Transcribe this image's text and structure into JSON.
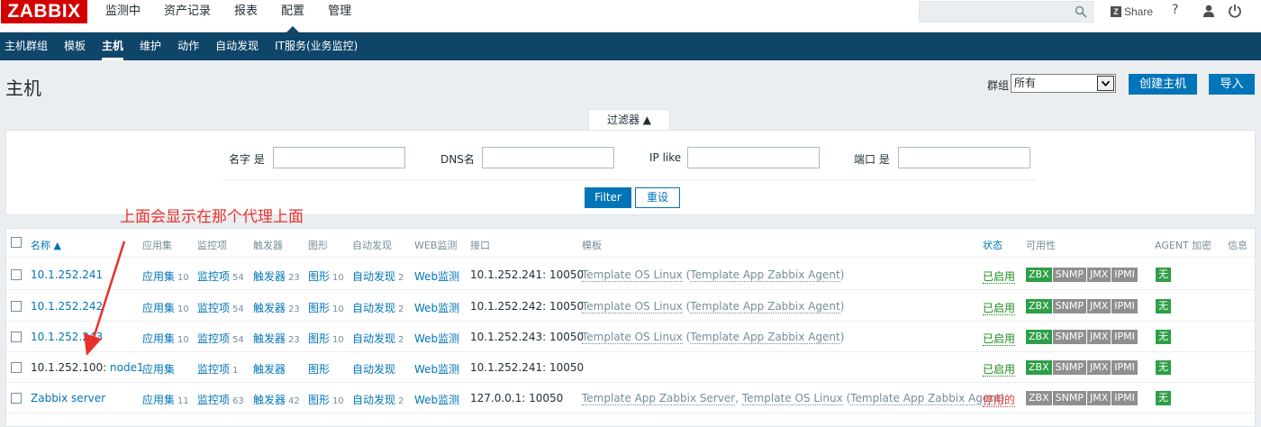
{
  "header": {
    "logo": "ZABBIX",
    "menu": [
      "监测中",
      "资产记录",
      "报表",
      "配置",
      "管理"
    ],
    "share": "Share",
    "share_box": "Z",
    "help": "?"
  },
  "subnav": [
    "主机群组",
    "模板",
    "主机",
    "维护",
    "动作",
    "自动发现",
    "IT服务(业务监控)"
  ],
  "page": {
    "title": "主机",
    "group_label": "群组",
    "group_value": "所有",
    "create_button": "创建主机",
    "import_button": "导入"
  },
  "filter": {
    "tab_label": "过滤器 ▲",
    "name_label": "名字 是",
    "dns_label": "DNS名",
    "ip_label": "IP like",
    "port_label": "端口 是",
    "filter_button": "Filter",
    "reset_button": "重设"
  },
  "annotation": "上面会显示在那个代理上面",
  "table": {
    "headers": {
      "name": "名称 ▲",
      "apps": "应用集",
      "items": "监控项",
      "triggers": "触发器",
      "graphs": "图形",
      "discovery": "自动发现",
      "web": "WEB监测",
      "interface": "接口",
      "templates": "模板",
      "status": "状态",
      "availability": "可用性",
      "encryption": "AGENT 加密",
      "info": "信息"
    },
    "rows": [
      {
        "name": "10.1.252.241",
        "proxy": "",
        "apps": "应用集",
        "apps_count": "10",
        "items": "监控项",
        "items_count": "54",
        "triggers": "触发器",
        "triggers_count": "23",
        "graphs": "图形",
        "graphs_count": "10",
        "discovery": "自动发现",
        "discovery_count": "2",
        "web": "Web监测",
        "interface": "10.1.252.241: 10050",
        "tmpl_1": "Template OS Linux",
        "tmpl_2": "",
        "tmpl_paren": "Template App Zabbix Agent",
        "status": "已启用",
        "zbx": "ZBX",
        "snmp": "SNMP",
        "jmx": "JMX",
        "ipmi": "IPMI",
        "encryption": "无"
      },
      {
        "name": "10.1.252.242",
        "proxy": "",
        "apps": "应用集",
        "apps_count": "10",
        "items": "监控项",
        "items_count": "54",
        "triggers": "触发器",
        "triggers_count": "23",
        "graphs": "图形",
        "graphs_count": "10",
        "discovery": "自动发现",
        "discovery_count": "2",
        "web": "Web监测",
        "interface": "10.1.252.242: 10050",
        "tmpl_1": "Template OS Linux",
        "tmpl_2": "",
        "tmpl_paren": "Template App Zabbix Agent",
        "status": "已启用",
        "zbx": "ZBX",
        "snmp": "SNMP",
        "jmx": "JMX",
        "ipmi": "IPMI",
        "encryption": "无"
      },
      {
        "name": "10.1.252.243",
        "proxy": "",
        "apps": "应用集",
        "apps_count": "10",
        "items": "监控项",
        "items_count": "54",
        "triggers": "触发器",
        "triggers_count": "23",
        "graphs": "图形",
        "graphs_count": "10",
        "discovery": "自动发现",
        "discovery_count": "2",
        "web": "Web监测",
        "interface": "10.1.252.243: 10050",
        "tmpl_1": "Template OS Linux",
        "tmpl_2": "",
        "tmpl_paren": "Template App Zabbix Agent",
        "status": "已启用",
        "zbx": "ZBX",
        "snmp": "SNMP",
        "jmx": "JMX",
        "ipmi": "IPMI",
        "encryption": "无"
      },
      {
        "name": "node1",
        "proxy": "10.1.252.100:",
        "apps": "应用集",
        "apps_count": "",
        "items": "监控项",
        "items_count": "1",
        "triggers": "触发器",
        "triggers_count": "",
        "graphs": "图形",
        "graphs_count": "",
        "discovery": "自动发现",
        "discovery_count": "",
        "web": "Web监测",
        "interface": "10.1.252.241: 10050",
        "tmpl_1": "",
        "tmpl_2": "",
        "tmpl_paren": "",
        "status": "已启用",
        "zbx": "ZBX",
        "snmp": "SNMP",
        "jmx": "JMX",
        "ipmi": "IPMI",
        "encryption": "无"
      },
      {
        "name": "Zabbix server",
        "proxy": "",
        "apps": "应用集",
        "apps_count": "11",
        "items": "监控项",
        "items_count": "63",
        "triggers": "触发器",
        "triggers_count": "42",
        "graphs": "图形",
        "graphs_count": "10",
        "discovery": "自动发现",
        "discovery_count": "2",
        "web": "Web监测",
        "interface": "127.0.0.1: 10050",
        "tmpl_1": "Template App Zabbix Server",
        "tmpl_2": "Template OS Linux",
        "tmpl_paren": "Template App Zabbix Agent",
        "status": "停用的",
        "zbx": "ZBX",
        "snmp": "SNMP",
        "jmx": "JMX",
        "ipmi": "IPMI",
        "encryption": "无"
      }
    ]
  },
  "colors": {
    "brand": "#d40000",
    "nav": "#0f4569",
    "link": "#0275b8",
    "enabled": "#1a8b1a",
    "disabled": "#e33734",
    "badge_on": "#2e9f46",
    "badge_off": "#8f8f8f",
    "annotation": "#e8302c"
  }
}
